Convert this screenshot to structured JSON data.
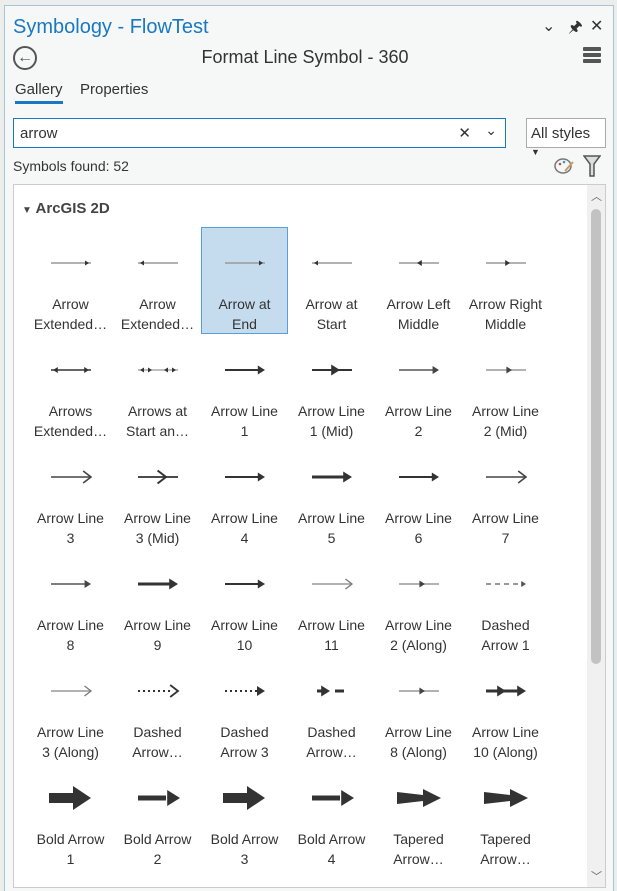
{
  "window": {
    "title": "Symbology - FlowTest",
    "buttons": [
      "⌄",
      "🖈",
      "✕"
    ]
  },
  "header": {
    "subtitle": "Format Line Symbol - 360"
  },
  "tabs": [
    {
      "label": "Gallery",
      "active": true
    },
    {
      "label": "Properties",
      "active": false
    }
  ],
  "search": {
    "value": "arrow",
    "style_filter": "All styles"
  },
  "status": {
    "found": "Symbols found: 52"
  },
  "accent": "#1a78c2",
  "gallery": {
    "group": "ArcGIS 2D",
    "selected_index": 2,
    "symbols": [
      {
        "l1": "Arrow",
        "l2": "Extended…",
        "icon": "thin-end"
      },
      {
        "l1": "Arrow",
        "l2": "Extended…",
        "icon": "thin-start"
      },
      {
        "l1": "Arrow at",
        "l2": "End",
        "icon": "thin-end"
      },
      {
        "l1": "Arrow at",
        "l2": "Start",
        "icon": "thin-start"
      },
      {
        "l1": "Arrow Left",
        "l2": "Middle",
        "icon": "mid-left"
      },
      {
        "l1": "Arrow Right",
        "l2": "Middle",
        "icon": "mid-right"
      },
      {
        "l1": "Arrows",
        "l2": "Extended…",
        "icon": "both-ends"
      },
      {
        "l1": "Arrows at",
        "l2": "Start an…",
        "icon": "both-ends-thin"
      },
      {
        "l1": "Arrow Line",
        "l2": "1",
        "icon": "line"
      },
      {
        "l1": "Arrow Line",
        "l2": "1 (Mid)",
        "icon": "line-mid"
      },
      {
        "l1": "Arrow Line",
        "l2": "2",
        "icon": "line-gray"
      },
      {
        "l1": "Arrow Line",
        "l2": "2 (Mid)",
        "icon": "mid-right-gray"
      },
      {
        "l1": "Arrow Line",
        "l2": "3",
        "icon": "open"
      },
      {
        "l1": "Arrow Line",
        "l2": "3 (Mid)",
        "icon": "open-mid"
      },
      {
        "l1": "Arrow Line",
        "l2": "4",
        "icon": "line"
      },
      {
        "l1": "Arrow Line",
        "l2": "5",
        "icon": "line-thick"
      },
      {
        "l1": "Arrow Line",
        "l2": "6",
        "icon": "line"
      },
      {
        "l1": "Arrow Line",
        "l2": "7",
        "icon": "open"
      },
      {
        "l1": "Arrow Line",
        "l2": "8",
        "icon": "line-gray"
      },
      {
        "l1": "Arrow Line",
        "l2": "9",
        "icon": "line-thick"
      },
      {
        "l1": "Arrow Line",
        "l2": "10",
        "icon": "line"
      },
      {
        "l1": "Arrow Line",
        "l2": "11",
        "icon": "open-light"
      },
      {
        "l1": "Arrow Line",
        "l2": "2 (Along)",
        "icon": "mid-right-gray"
      },
      {
        "l1": "Dashed",
        "l2": "Arrow 1",
        "icon": "dashed-gray"
      },
      {
        "l1": "Arrow Line",
        "l2": "3 (Along)",
        "icon": "open-light"
      },
      {
        "l1": "Dashed",
        "l2": "Arrow…",
        "icon": "dashed-open"
      },
      {
        "l1": "Dashed",
        "l2": "Arrow 3",
        "icon": "dashed-filled"
      },
      {
        "l1": "Dashed",
        "l2": "Arrow…",
        "icon": "dash-head"
      },
      {
        "l1": "Arrow Line",
        "l2": "8 (Along)",
        "icon": "mid-right-gray"
      },
      {
        "l1": "Arrow Line",
        "l2": "10 (Along)",
        "icon": "double-head"
      },
      {
        "l1": "Bold Arrow",
        "l2": "1",
        "icon": "bold-fat"
      },
      {
        "l1": "Bold Arrow",
        "l2": "2",
        "icon": "bold"
      },
      {
        "l1": "Bold Arrow",
        "l2": "3",
        "icon": "bold-fat"
      },
      {
        "l1": "Bold Arrow",
        "l2": "4",
        "icon": "bold"
      },
      {
        "l1": "Tapered",
        "l2": "Arrow…",
        "icon": "tapered"
      },
      {
        "l1": "Tapered",
        "l2": "Arrow…",
        "icon": "tapered"
      }
    ]
  }
}
